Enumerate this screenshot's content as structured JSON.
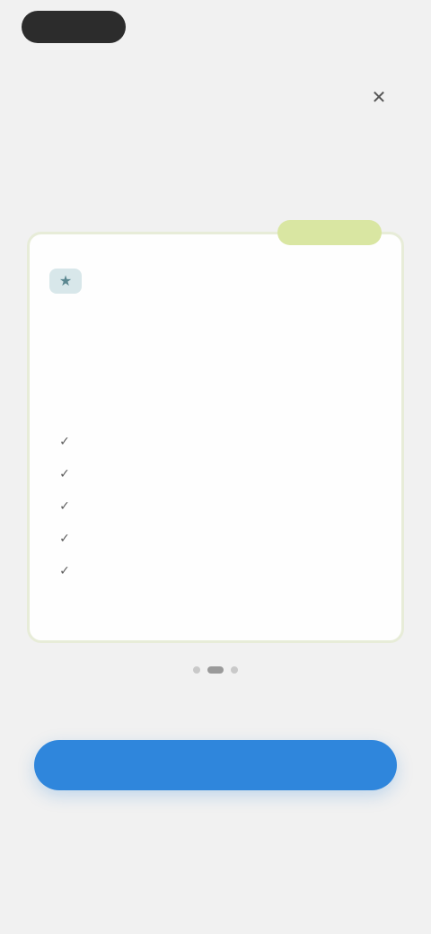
{
  "top": {
    "back_label": "",
    "restore_label": ""
  },
  "hero": {
    "title": "",
    "subtitle": ""
  },
  "plan": {
    "badge": "",
    "name": "",
    "description": "",
    "features": [
      "",
      "",
      "",
      "",
      ""
    ]
  },
  "cta": {
    "label": "",
    "price": "",
    "subtext": ""
  },
  "legal": {
    "text": "",
    "terms_link": "",
    "privacy_link": ""
  },
  "colors": {
    "accent": "#2f86dc",
    "badge_bg": "#d9e6a2",
    "card_border": "#e7ecd8"
  },
  "icons": {
    "close": "close-icon",
    "plan": "plan-icon",
    "feature": "check-icon"
  }
}
